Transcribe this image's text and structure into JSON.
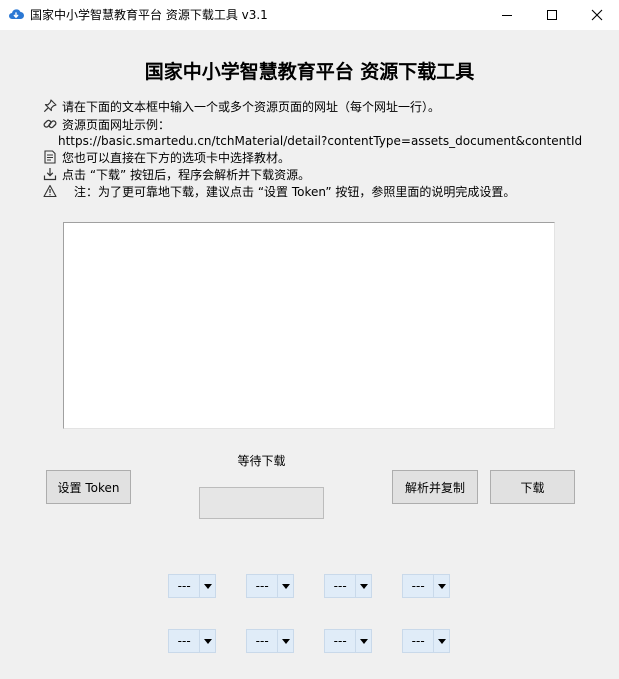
{
  "window": {
    "title": "国家中小学智慧教育平台 资源下载工具 v3.1",
    "icon": "cloud-download-icon"
  },
  "main_title": "国家中小学智慧教育平台 资源下载工具",
  "instructions": [
    {
      "icon": "pin-icon",
      "text": "请在下面的文本框中输入一个或多个资源页面的网址（每个网址一行）。"
    },
    {
      "icon": "link-icon",
      "text": "资源页面网址示例："
    },
    {
      "icon": "",
      "text": "https://basic.smartedu.cn/tchMaterial/detail?contentType=assets_document&contentId=..."
    },
    {
      "icon": "document-icon",
      "text": "您也可以直接在下方的选项卡中选择教材。"
    },
    {
      "icon": "download-tray-icon",
      "text": "点击 “下载” 按钮后，程序会解析并下载资源。"
    },
    {
      "icon": "warning-icon",
      "text": "注：为了更可靠地下载，建议点击 “设置 Token” 按钮，参照里面的说明完成设置。"
    }
  ],
  "url_input": {
    "value": "",
    "placeholder": ""
  },
  "buttons": {
    "set_token": "设置 Token",
    "parse_copy": "解析并复制",
    "download": "下载"
  },
  "status": {
    "label": "等待下载",
    "progress": 0
  },
  "selectors": {
    "row1": [
      "---",
      "---",
      "---",
      "---"
    ],
    "row2": [
      "---",
      "---",
      "---",
      "---"
    ]
  },
  "colors": {
    "background": "#f0f0f0",
    "button": "#e1e1e1",
    "combo": "#e0ecf8",
    "progress_fill": "#06b025"
  }
}
